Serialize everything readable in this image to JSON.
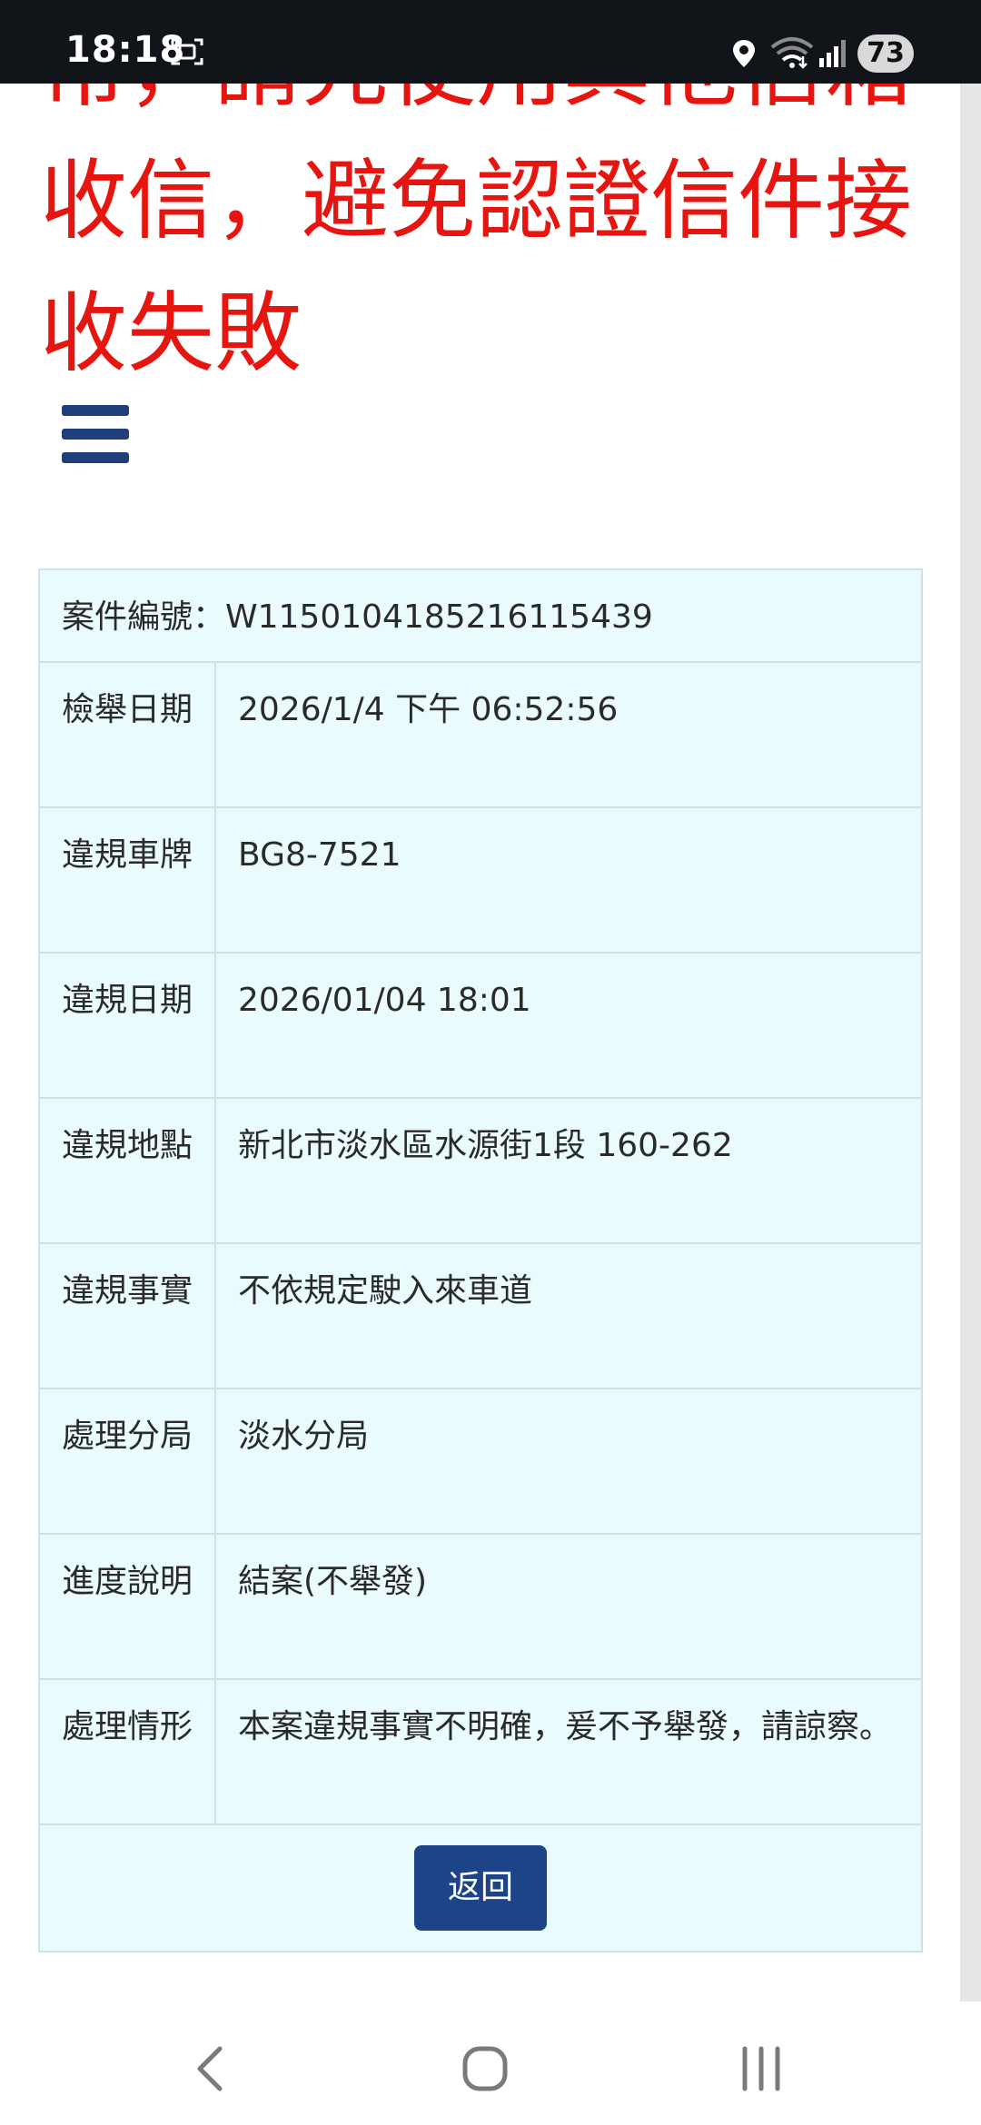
{
  "status_bar": {
    "time": "18:18",
    "battery": "73",
    "icons": [
      "screenshot-icon",
      "location-icon",
      "wifi-icon",
      "signal-icon"
    ]
  },
  "notice": {
    "text": "常，請先使用其他信箱收信，避免認證信件接收失敗",
    "color": "#e6150f"
  },
  "case": {
    "number_label": "案件編號：",
    "number_value": "W1150104185216115439",
    "rows": [
      {
        "label": "檢舉日期",
        "value": "2026/1/4 下午 06:52:56"
      },
      {
        "label": "違規車牌",
        "value": "BG8-7521"
      },
      {
        "label": "違規日期",
        "value": "2026/01/04 18:01"
      },
      {
        "label": "違規地點",
        "value": "新北市淡水區水源街1段 160-262"
      },
      {
        "label": "違規事實",
        "value": "不依規定駛入來車道"
      },
      {
        "label": "處理分局",
        "value": "淡水分局"
      },
      {
        "label": "進度說明",
        "value": "結案(不舉發)"
      },
      {
        "label": "處理情形",
        "value": "本案違規事實不明確，爰不予舉發，請諒察。"
      }
    ],
    "back_label": "返回"
  },
  "colors": {
    "table_bg": "#eafbfd",
    "table_border": "#cfe1e3",
    "button_bg": "#1e4488",
    "menu_icon": "#1e3f79",
    "status_bar_bg": "#111418"
  },
  "nav_bar": {
    "icons": [
      "back-icon",
      "home-icon",
      "recent-apps-icon"
    ]
  }
}
